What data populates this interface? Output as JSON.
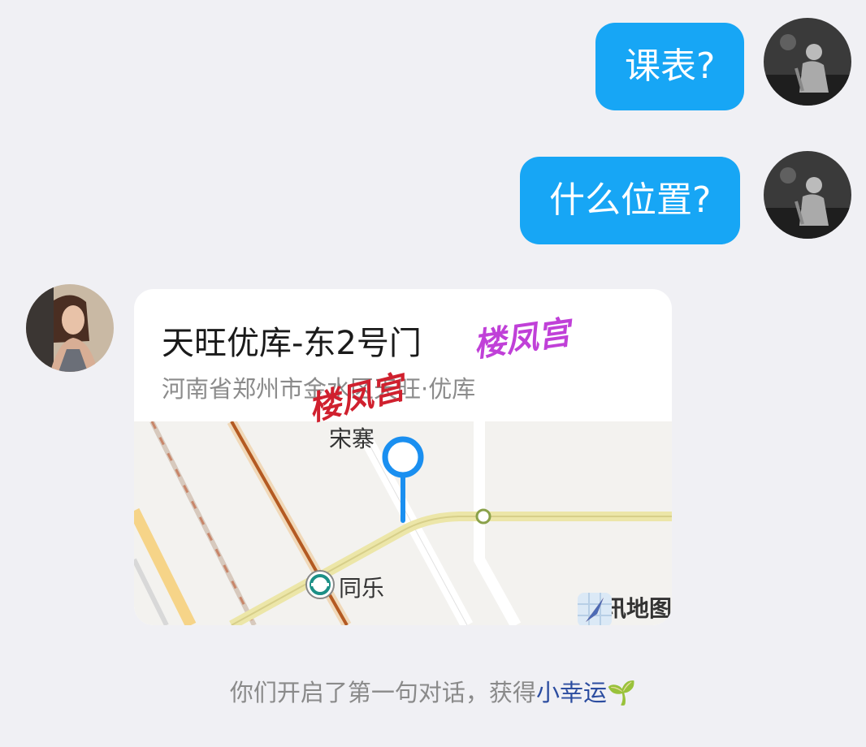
{
  "messages": [
    {
      "side": "right",
      "text": "课表?"
    },
    {
      "side": "right",
      "text": "什么位置?"
    }
  ],
  "location_card": {
    "title": "天旺优库-东2号门",
    "address": "河南省郑州市金水区天旺·优库",
    "map": {
      "labels": {
        "top": "宋寨",
        "station": "同乐"
      },
      "brand": "腾讯地图"
    }
  },
  "watermarks": [
    "楼凤宫",
    "楼凤宫"
  ],
  "system": {
    "prefix": "你们开启了第一句对话，获得",
    "highlight": "小幸运",
    "emoji": "🌱"
  },
  "colors": {
    "bubble": "#17a6f5",
    "background": "#f0f0f4",
    "pin": "#1a8ff0",
    "highlight": "#2c4da0"
  }
}
